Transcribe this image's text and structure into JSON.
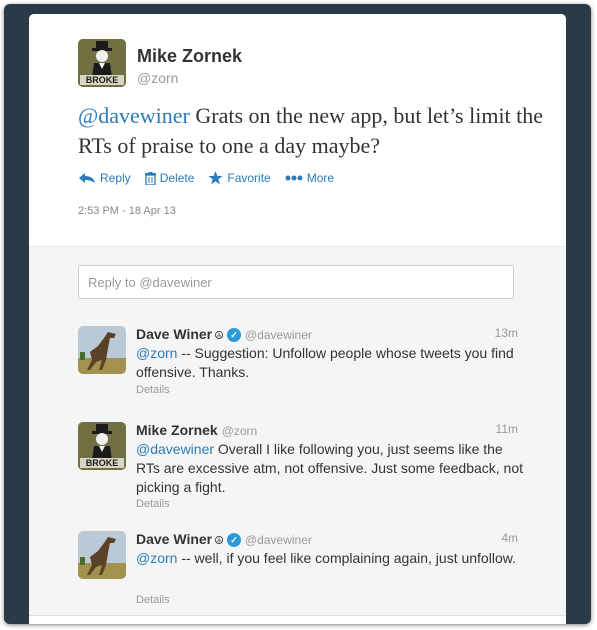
{
  "main_tweet": {
    "author_name": "Mike Zornek",
    "author_handle": "@zorn",
    "avatar_label": "BROKE",
    "mention": "@davewiner",
    "text": " Grats on the new app, but let’s limit the RTs of praise to one a day maybe?",
    "actions": {
      "reply": "Reply",
      "delete": "Delete",
      "favorite": "Favorite",
      "more": "More"
    },
    "timestamp": "2:53 PM - 18 Apr 13"
  },
  "reply_box": {
    "prefix": "Reply to ",
    "mention": "@davewiner"
  },
  "thread": [
    {
      "name": "Dave Winer",
      "peace": "☮",
      "verified": true,
      "handle": "@davewiner",
      "time": "13m",
      "mention": "@zorn",
      "text": " -- Suggestion: Unfollow people whose tweets you find offensive. Thanks.",
      "details": "Details"
    },
    {
      "name": "Mike Zornek",
      "handle": "@zorn",
      "time": "11m",
      "avatar_label": "BROKE",
      "mention": "@davewiner",
      "text": " Overall I like following you, just seems like the RTs are excessive atm, not offensive. Just some feedback, not picking a fight.",
      "details": "Details"
    },
    {
      "name": "Dave Winer",
      "peace": "☮",
      "verified": true,
      "handle": "@davewiner",
      "time": "4m",
      "mention": "@zorn",
      "text": " -- well, if you feel like complaining again, just unfollow.",
      "details": "Details"
    }
  ],
  "colors": {
    "link": "#2b7bb9",
    "verified": "#2b9bd9",
    "frame": "#2b3a47"
  }
}
